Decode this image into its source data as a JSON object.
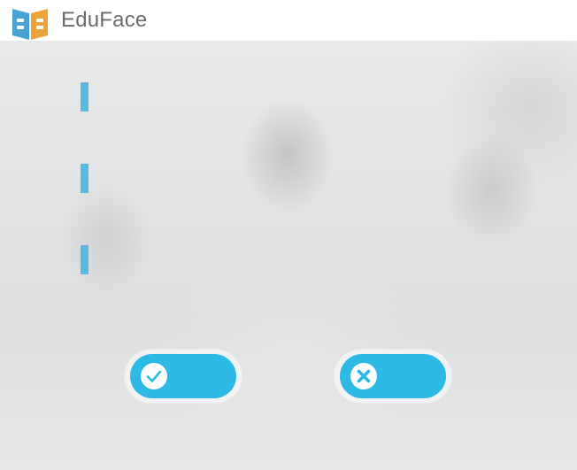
{
  "app": {
    "brand": "EduFace",
    "logo_icon": "open-book-icon"
  },
  "form": {
    "rows": [
      {
        "marker": "accent-bar",
        "label": ""
      },
      {
        "marker": "accent-bar",
        "label": ""
      },
      {
        "marker": "accent-bar",
        "label": ""
      }
    ]
  },
  "actions": {
    "confirm": {
      "icon": "check-circle-icon",
      "label": ""
    },
    "cancel": {
      "icon": "close-circle-icon",
      "label": ""
    }
  },
  "colors": {
    "accent": "#2cb9e6",
    "marker": "#5ab9de",
    "logo_blue": "#4aa3d6",
    "logo_orange": "#f0a23a"
  }
}
